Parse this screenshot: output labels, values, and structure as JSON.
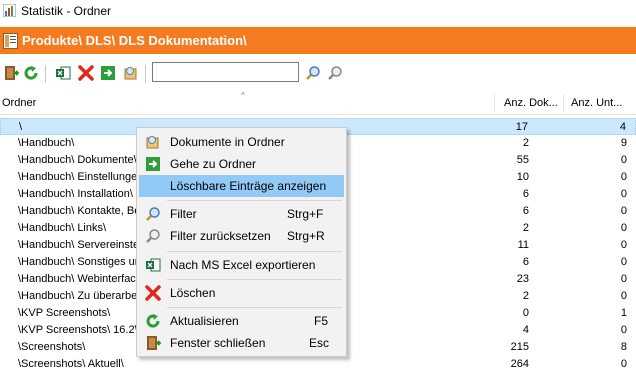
{
  "window": {
    "title": "Statistik - Ordner"
  },
  "pathbar": {
    "path": "Produkte\\ DLS\\ DLS Dokumentation\\"
  },
  "search": {
    "value": ""
  },
  "columns": {
    "name": "Ordner",
    "docs": "Anz. Dok...",
    "sub": "Anz. Unt..."
  },
  "rows": [
    {
      "name": "\\",
      "docs": "17",
      "sub": "4"
    },
    {
      "name": "\\Handbuch\\",
      "docs": "2",
      "sub": "9"
    },
    {
      "name": "\\Handbuch\\ Dokumente\\",
      "docs": "55",
      "sub": "0"
    },
    {
      "name": "\\Handbuch\\ Einstellungen\\",
      "docs": "10",
      "sub": "0"
    },
    {
      "name": "\\Handbuch\\ Installation\\",
      "docs": "6",
      "sub": "0"
    },
    {
      "name": "\\Handbuch\\ Kontakte, Be",
      "docs": "6",
      "sub": "0"
    },
    {
      "name": "\\Handbuch\\ Links\\",
      "docs": "2",
      "sub": "0"
    },
    {
      "name": "\\Handbuch\\ Servereinste",
      "docs": "11",
      "sub": "0"
    },
    {
      "name": "\\Handbuch\\ Sonstiges ur",
      "docs": "6",
      "sub": "0"
    },
    {
      "name": "\\Handbuch\\ Webinterfac",
      "docs": "23",
      "sub": "0"
    },
    {
      "name": "\\Handbuch\\ Zu überarbe",
      "docs": "2",
      "sub": "0"
    },
    {
      "name": "\\KVP Screenshots\\",
      "docs": "0",
      "sub": "1"
    },
    {
      "name": "\\KVP Screenshots\\ 16.2\\",
      "docs": "4",
      "sub": "0"
    },
    {
      "name": "\\Screenshots\\",
      "docs": "215",
      "sub": "8"
    },
    {
      "name": "\\Screenshots\\ Aktuell\\",
      "docs": "264",
      "sub": "0"
    }
  ],
  "menu": {
    "items": [
      {
        "label": "Dokumente in Ordner",
        "key": ""
      },
      {
        "label": "Gehe zu Ordner",
        "key": ""
      },
      {
        "label": "Löschbare Einträge anzeigen",
        "key": ""
      },
      {
        "label": "Filter",
        "key": "Strg+F"
      },
      {
        "label": "Filter zurücksetzen",
        "key": "Strg+R"
      },
      {
        "label": "Nach MS Excel exportieren",
        "key": ""
      },
      {
        "label": "Löschen",
        "key": ""
      },
      {
        "label": "Aktualisieren",
        "key": "F5"
      },
      {
        "label": "Fenster schließen",
        "key": "Esc"
      }
    ]
  },
  "colors": {
    "accent": "#f47b20",
    "selection": "#cce8ff",
    "menu_highlight": "#91c9f7"
  }
}
